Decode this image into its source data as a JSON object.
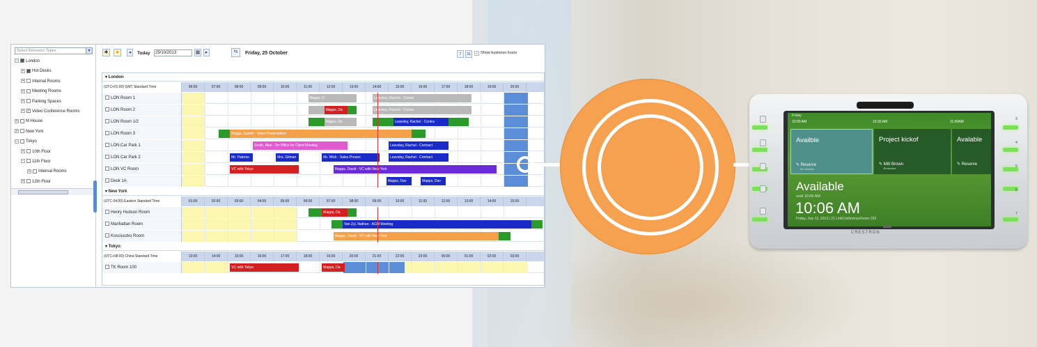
{
  "tree": {
    "select_placeholder": "Select Resource Types",
    "items": [
      {
        "label": "London",
        "level": 0,
        "exp": "−",
        "checked": "partial"
      },
      {
        "label": "Hot Desks",
        "level": 1,
        "exp": "+",
        "checked": "partial"
      },
      {
        "label": "Internal Rooms",
        "level": 1,
        "exp": "+",
        "checked": "off"
      },
      {
        "label": "Meeting Rooms",
        "level": 1,
        "exp": "+",
        "checked": "off"
      },
      {
        "label": "Parking Spaces",
        "level": 1,
        "exp": "+",
        "checked": "off"
      },
      {
        "label": "Video Conference Rooms",
        "level": 1,
        "exp": "+",
        "checked": "on"
      },
      {
        "label": "M House",
        "level": 0,
        "exp": "+",
        "checked": "off"
      },
      {
        "label": "New York",
        "level": 0,
        "exp": "+",
        "checked": "off"
      },
      {
        "label": "Tokyo",
        "level": 0,
        "exp": "−",
        "checked": "off"
      },
      {
        "label": "10th Floor",
        "level": 1,
        "exp": "+",
        "checked": "off"
      },
      {
        "label": "11th Floor",
        "level": 1,
        "exp": "−",
        "checked": "off"
      },
      {
        "label": "Internal Rooms",
        "level": 2,
        "exp": "+",
        "checked": "off"
      },
      {
        "label": "12th Floor",
        "level": 1,
        "exp": "+",
        "checked": "off"
      }
    ]
  },
  "toolbar": {
    "today_label": "Today",
    "date_value": "25/10/2013",
    "day_title": "Friday, 25 October",
    "business_hours_label": "Show business hours",
    "business_hours_checked": true
  },
  "sections": [
    {
      "name": "London",
      "timezone": "(UTC+01:00) GMT Standard Time",
      "hours": [
        "06:00",
        "07:00",
        "08:00",
        "09:00",
        "10:00",
        "11:00",
        "12:00",
        "13:00",
        "14:00",
        "15:00",
        "16:00",
        "17:00",
        "18:00",
        "19:00",
        "20:00"
      ],
      "rows": [
        {
          "label": "LON Room 1",
          "events": [
            {
              "start": 5.5,
              "end": 7.6,
              "color": "#b9b9b9",
              "text": "Mapps, D"
            },
            {
              "start": 8.3,
              "end": 12.6,
              "color": "#b9b9b9",
              "text": "Leavsley, Rachel - Contra"
            }
          ]
        },
        {
          "label": "LON Room 2",
          "events": [
            {
              "start": 5.5,
              "end": 6.2,
              "color": "#b9b9b9",
              "text": ""
            },
            {
              "start": 6.2,
              "end": 7.2,
              "color": "#d42020",
              "text": "Mapps, Da"
            },
            {
              "start": 7.2,
              "end": 7.6,
              "color": "#2a9a2a",
              "text": ""
            },
            {
              "start": 8.3,
              "end": 12.6,
              "color": "#b9b9b9",
              "text": "Leavsley, Rachel - Contra"
            }
          ]
        },
        {
          "label": "LON Room 1/2",
          "events": [
            {
              "start": 5.5,
              "end": 6.2,
              "color": "#2a9a2a",
              "text": ""
            },
            {
              "start": 6.2,
              "end": 7.6,
              "color": "#b9b9b9",
              "text": "Mapps, Da"
            },
            {
              "start": 8.3,
              "end": 9.2,
              "color": "#2a9a2a",
              "text": ""
            },
            {
              "start": 9.2,
              "end": 11.6,
              "color": "#1a2ac8",
              "text": "Leavsley, Rachel - Contra"
            },
            {
              "start": 11.6,
              "end": 12.5,
              "color": "#2a9a2a",
              "text": ""
            }
          ]
        },
        {
          "label": "LON Room 3",
          "events": [
            {
              "start": 1.6,
              "end": 2.1,
              "color": "#2a9a2a",
              "text": ""
            },
            {
              "start": 2.1,
              "end": 10.0,
              "color": "#f5a14a",
              "text": "Boggs, Gareth - Sales Presentation"
            },
            {
              "start": 10.0,
              "end": 10.6,
              "color": "#2a9a2a",
              "text": ""
            }
          ]
        },
        {
          "label": "LON Car Park 1",
          "events": [
            {
              "start": 3.1,
              "end": 7.2,
              "color": "#e05ad0",
              "text": "Smith, Alan - 3rr Office for Client Meeting"
            },
            {
              "start": 9.0,
              "end": 11.6,
              "color": "#1a2ac8",
              "text": "Leavsley, Rachel - Contract"
            }
          ]
        },
        {
          "label": "LON Car Park 2",
          "events": [
            {
              "start": 2.1,
              "end": 3.1,
              "color": "#1a2ac8",
              "text": "Mr. Paterso"
            },
            {
              "start": 4.1,
              "end": 5.1,
              "color": "#1a2ac8",
              "text": "Mrs. Gilman"
            },
            {
              "start": 6.1,
              "end": 8.6,
              "color": "#1a2ac8",
              "text": "Mr. Wick - Sales Presen"
            },
            {
              "start": 9.0,
              "end": 11.6,
              "color": "#1a2ac8",
              "text": "Leavsley, Rachel - Contract"
            }
          ]
        },
        {
          "label": "LON VC Room",
          "events": [
            {
              "start": 2.1,
              "end": 5.1,
              "color": "#d42020",
              "text": "VC with Tokyo"
            },
            {
              "start": 6.6,
              "end": 13.7,
              "color": "#6a2ad8",
              "text": "Mapps, David - VC with New York"
            }
          ]
        },
        {
          "label": "Desk 1A",
          "events": [
            {
              "start": 8.9,
              "end": 10.0,
              "color": "#1a2ac8",
              "text": "Mapps, Dav"
            },
            {
              "start": 10.0,
              "end": 11.0,
              "color": "#ffffff",
              "text": ""
            },
            {
              "start": 10.4,
              "end": 11.5,
              "color": "#1a2ac8",
              "text": "Mapps, Dav"
            }
          ]
        }
      ]
    },
    {
      "name": "New York",
      "timezone": "(UTC-04:00) Eastern Standard Time",
      "hours": [
        "01:00",
        "02:00",
        "03:00",
        "04:00",
        "05:00",
        "06:00",
        "07:00",
        "08:00",
        "09:00",
        "10:00",
        "11:00",
        "12:00",
        "13:00",
        "14:00",
        "15:00"
      ],
      "rows": [
        {
          "label": "Henry Hudson Room",
          "events": [
            {
              "start": 5.5,
              "end": 6.1,
              "color": "#2a9a2a",
              "text": ""
            },
            {
              "start": 6.1,
              "end": 7.2,
              "color": "#d42020",
              "text": "Mapps, Da"
            },
            {
              "start": 7.2,
              "end": 7.6,
              "color": "#2a9a2a",
              "text": ""
            }
          ]
        },
        {
          "label": "Manhattan Room",
          "events": [
            {
              "start": 6.5,
              "end": 7.0,
              "color": "#2a9a2a",
              "text": ""
            },
            {
              "start": 7.0,
              "end": 15.2,
              "color": "#1a2ac8",
              "text": "Van Zyl, Nathan - AGM Meeting"
            },
            {
              "start": 15.2,
              "end": 15.7,
              "color": "#2a9a2a",
              "text": ""
            }
          ]
        },
        {
          "label": "Kosciuszko Room",
          "events": [
            {
              "start": 5.5,
              "end": 6.6,
              "color": "#ffffff",
              "text": ""
            },
            {
              "start": 6.6,
              "end": 13.8,
              "color": "#f5a14a",
              "text": "Mapps, David - VC with New York"
            },
            {
              "start": 13.8,
              "end": 14.3,
              "color": "#2a9a2a",
              "text": ""
            }
          ]
        }
      ]
    },
    {
      "name": "Tokyo",
      "timezone": "(UTC+08:00) China Standard Time",
      "hours": [
        "13:00",
        "14:00",
        "15:00",
        "16:00",
        "17:00",
        "18:00",
        "19:00",
        "20:00",
        "21:00",
        "22:00",
        "23:00",
        "00:00",
        "01:00",
        "02:00",
        "03:00"
      ],
      "rows": [
        {
          "label": "TK Room 100",
          "events": [
            {
              "start": 2.1,
              "end": 5.1,
              "color": "#d42020",
              "text": "VC with Tokyo"
            },
            {
              "start": 6.1,
              "end": 7.1,
              "color": "#d42020",
              "text": "Mapps, Da"
            }
          ]
        }
      ]
    }
  ],
  "device": {
    "brand": "CRESTRON",
    "day": "Friday",
    "timeline": [
      "10:00 AM",
      "10:30 AM",
      "11:00AM"
    ],
    "tiles": [
      {
        "title": "Availble",
        "action": "Reserve",
        "sub": "50 minutes",
        "color": "#4e8f8a"
      },
      {
        "title": "Project kickof",
        "action": "Mitt Brown",
        "sub": "30minutes",
        "color": "#265a26"
      },
      {
        "title": "Avalable",
        "action": "Reserve",
        "sub": "",
        "color": "#265a26"
      }
    ],
    "status": "Available",
    "until": "until 10:00 AM",
    "clock": "10:06 AM",
    "room_info": "Friday, July 12, 2013 | 21 LinkConferenceRoom 233",
    "side_numbers": [
      "3",
      "4",
      "5",
      "6",
      "7"
    ]
  }
}
